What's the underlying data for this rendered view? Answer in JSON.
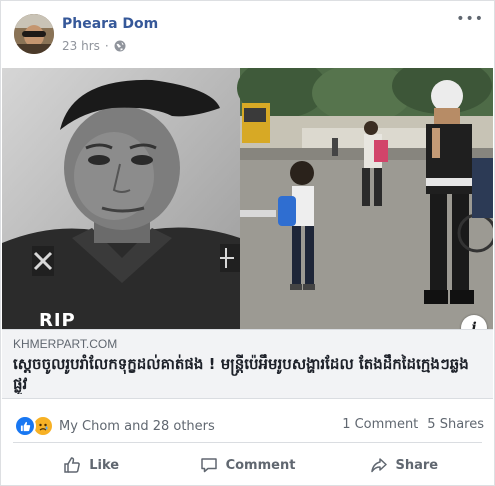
{
  "post": {
    "author": "Pheara Dom",
    "timestamp": "23 hrs",
    "separator": "·",
    "privacy_icon": "globe-icon",
    "more_label": "•••"
  },
  "photo": {
    "overlay_text": "RIP",
    "info_label": "i"
  },
  "link": {
    "domain": "KHMERPART.COM",
    "title": "ស្ដេចចូលរូបរាំ​លែកទុក្ខដល់គាត់ផង ! មន្ត្រីប៉េអឹមរូបសង្ហារដែល តែងដឹកដៃក្មេងៗឆ្លងផ្លូវ"
  },
  "reactions": {
    "text": "My Chom and 28 others",
    "comments": "1 Comment",
    "shares": "5 Shares",
    "icons": [
      "like-icon",
      "sad-icon"
    ]
  },
  "actions": {
    "like": "Like",
    "comment": "Comment",
    "share": "Share"
  },
  "colors": {
    "author": "#365899",
    "like_blue": "#1877f2",
    "sad_yellow": "#f7b125",
    "muted": "#606770"
  }
}
